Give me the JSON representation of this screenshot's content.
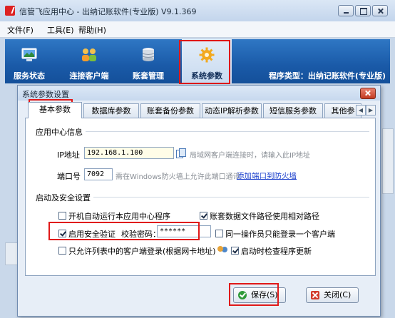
{
  "window": {
    "title": "信管飞应用中心 - 出纳记账软件(专业版) V9.1.369"
  },
  "menu": [
    {
      "label": "文件(F)"
    },
    {
      "label": "工具(E)"
    },
    {
      "label": "帮助(H)"
    }
  ],
  "toolbar": {
    "items": [
      {
        "label": "服务状态",
        "icon": "monitor-icon"
      },
      {
        "label": "连接客户端",
        "icon": "users-icon"
      },
      {
        "label": "账套管理",
        "icon": "database-icon"
      },
      {
        "label": "系统参数",
        "icon": "gear-icon",
        "selected": true
      }
    ],
    "program_type": "程序类型：出纳记账软件(专业版)"
  },
  "dialog": {
    "title": "系统参数设置",
    "tabs": [
      {
        "label": "基本参数",
        "active": true
      },
      {
        "label": "数据库参数"
      },
      {
        "label": "账套备份参数"
      },
      {
        "label": "动态IP解析参数"
      },
      {
        "label": "短信服务参数"
      },
      {
        "label": "其他参"
      }
    ],
    "app_center": {
      "group_title": "应用中心信息",
      "ip_label": "IP地址",
      "ip_value": "192.168.1.100",
      "ip_hint": "局域网客户端连接时，请输入此IP地址",
      "port_label": "端口号",
      "port_value": "7092",
      "port_hint": "需在Windows防火墙上允许此端口通讯",
      "firewall_link": "添加端口到防火墙"
    },
    "security": {
      "group_title": "启动及安全设置",
      "autostart_label": "开机自动运行本应用中心程序",
      "autostart_checked": false,
      "relative_path_label": "账套数据文件路径使用相对路径",
      "relative_path_checked": true,
      "enable_verify_label": "启用安全验证",
      "enable_verify_checked": true,
      "verify_password_label": "校验密码：",
      "verify_password_value": "******",
      "single_client_label": "同一操作员只能登录一个客户端",
      "single_client_checked": false,
      "whitelist_label": "只允许列表中的客户端登录(根据网卡地址)",
      "whitelist_checked": false,
      "check_update_label": "启动时检查程序更新",
      "check_update_checked": true
    },
    "buttons": {
      "save": "保存(S)",
      "close": "关闭(C)"
    }
  }
}
